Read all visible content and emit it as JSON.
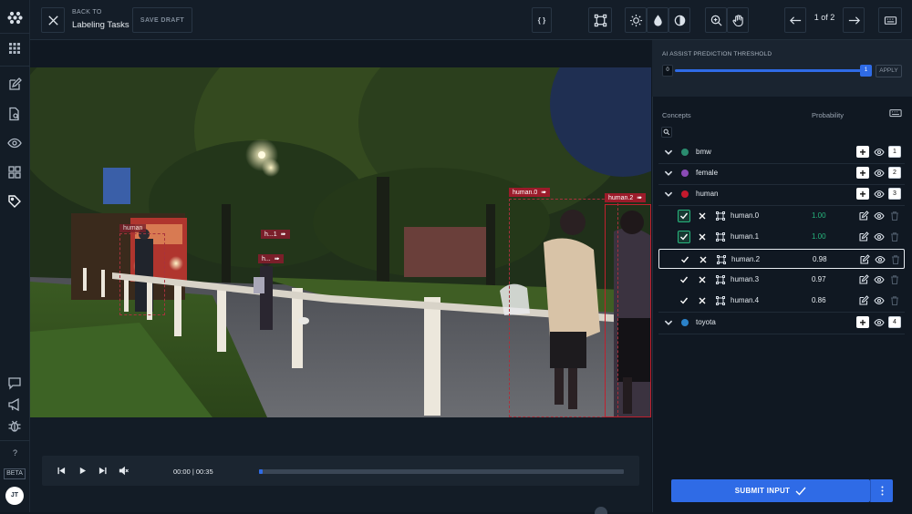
{
  "topbar": {
    "back_caption": "BACK TO",
    "back_target": "Labeling Tasks",
    "save_draft": "SAVE DRAFT",
    "json_label": "{ }",
    "pagination": "1 of 2"
  },
  "rail": {
    "beta": "BETA",
    "avatar": "JT",
    "help": "?"
  },
  "video": {
    "labels": [
      "human.0",
      "human.2",
      "human",
      "h...1",
      "h..."
    ]
  },
  "player": {
    "time": "00:00 | 00:35",
    "progress": 0.01
  },
  "threshold": {
    "title": "AI ASSIST PREDICTION THRESHOLD",
    "min_label": "0",
    "value_label": "1",
    "apply": "APPLY",
    "value": 1.0
  },
  "concepts": {
    "header": "Concepts",
    "probability_header": "Probability",
    "groups": [
      {
        "name": "bmw",
        "color": "#2a8c6f",
        "count": "1"
      },
      {
        "name": "female",
        "color": "#8a4bb6",
        "count": "2"
      },
      {
        "name": "human",
        "color": "#c4192d",
        "count": "3"
      },
      {
        "name": "toyota",
        "color": "#2b82c9",
        "count": "4"
      }
    ],
    "instances": [
      {
        "name": "human.0",
        "prob": "1.00",
        "prob_color": "#27b57d"
      },
      {
        "name": "human.1",
        "prob": "1.00",
        "prob_color": "#27b57d"
      },
      {
        "name": "human.2",
        "prob": "0.98",
        "prob_color": "#e8edf2"
      },
      {
        "name": "human.3",
        "prob": "0.97",
        "prob_color": "#e8edf2"
      },
      {
        "name": "human.4",
        "prob": "0.86",
        "prob_color": "#e8edf2"
      }
    ]
  },
  "submit": {
    "label": "SUBMIT INPUT"
  },
  "colors": {
    "accent": "#2f6be6",
    "confirm": "#27b57d",
    "bbox": "#c0202e"
  }
}
